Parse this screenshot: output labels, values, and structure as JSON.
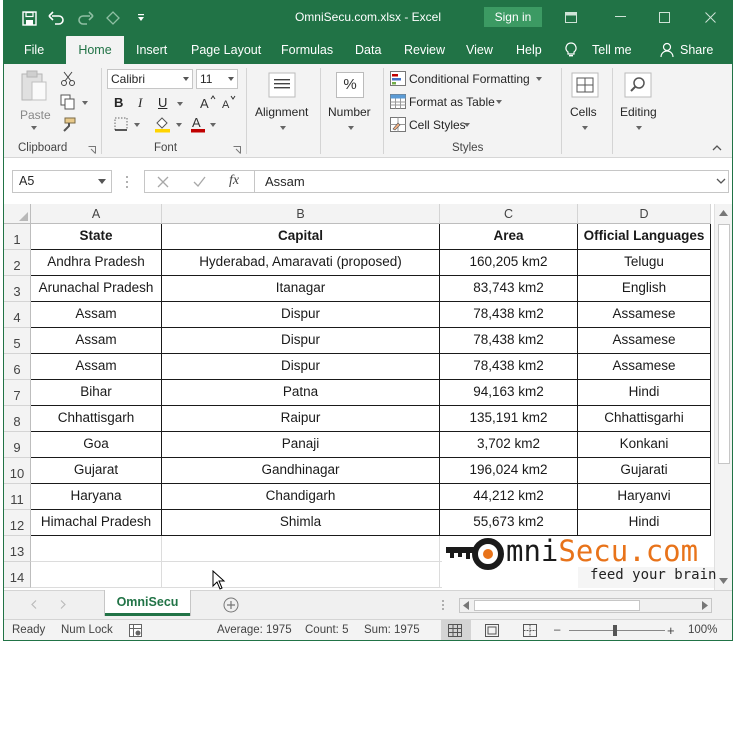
{
  "window": {
    "title": "OmniSecu.com.xlsx  -  Excel",
    "sign_in": "Sign in"
  },
  "tabs": [
    "File",
    "Home",
    "Insert",
    "Page Layout",
    "Formulas",
    "Data",
    "Review",
    "View",
    "Help",
    "Tell me",
    "Share"
  ],
  "ribbon": {
    "paste": "Paste",
    "clipboard": "Clipboard",
    "font_name": "Calibri",
    "font_size": "11",
    "font_group": "Font",
    "alignment": "Alignment",
    "number": "Number",
    "percent": "%",
    "conditional_formatting": "Conditional Formatting",
    "format_as_table": "Format as Table",
    "cell_styles": "Cell Styles",
    "styles_group": "Styles",
    "cells": "Cells",
    "editing": "Editing",
    "bold": "B",
    "italic": "I",
    "underline": "U"
  },
  "formula_bar": {
    "name_box": "A5",
    "formula": "Assam",
    "fx": "fx"
  },
  "grid": {
    "columns": [
      "A",
      "B",
      "C",
      "D"
    ],
    "row_numbers": [
      "1",
      "2",
      "3",
      "4",
      "5",
      "6",
      "7",
      "8",
      "9",
      "10",
      "11",
      "12",
      "13",
      "14"
    ],
    "header": [
      "State",
      "Capital",
      "Area",
      "Official Languages"
    ],
    "rows": [
      [
        "Andhra Pradesh",
        "Hyderabad, Amaravati (proposed)",
        "160,205 km2",
        "Telugu"
      ],
      [
        "Arunachal Pradesh",
        "Itanagar",
        "83,743 km2",
        "English"
      ],
      [
        "Assam",
        "Dispur",
        "78,438 km2",
        "Assamese"
      ],
      [
        "Assam",
        "Dispur",
        "78,438 km2",
        "Assamese"
      ],
      [
        "Assam",
        "Dispur",
        "78,438 km2",
        "Assamese"
      ],
      [
        "Bihar",
        "Patna",
        "94,163 km2",
        "Hindi"
      ],
      [
        "Chhattisgarh",
        "Raipur",
        "135,191 km2",
        "Chhattisgarhi"
      ],
      [
        "Goa",
        "Panaji",
        "3,702 km2",
        "Konkani"
      ],
      [
        "Gujarat",
        "Gandhinagar",
        "196,024 km2",
        "Gujarati"
      ],
      [
        "Haryana",
        "Chandigarh",
        "44,212 km2",
        "Haryanvi"
      ],
      [
        "Himachal Pradesh",
        "Shimla",
        "55,673 km2",
        "Hindi"
      ]
    ]
  },
  "sheet": {
    "tab_name": "OmniSecu"
  },
  "status": {
    "ready": "Ready",
    "num_lock": "Num Lock",
    "average": "Average: 1975",
    "count": "Count: 5",
    "sum": "Sum: 1975",
    "zoom": "100%"
  },
  "logo": {
    "brand": "OmniSecu.com",
    "tagline": "feed your brain"
  },
  "colors": {
    "excel_green": "#217346",
    "logo_orange": "#e8731a"
  }
}
